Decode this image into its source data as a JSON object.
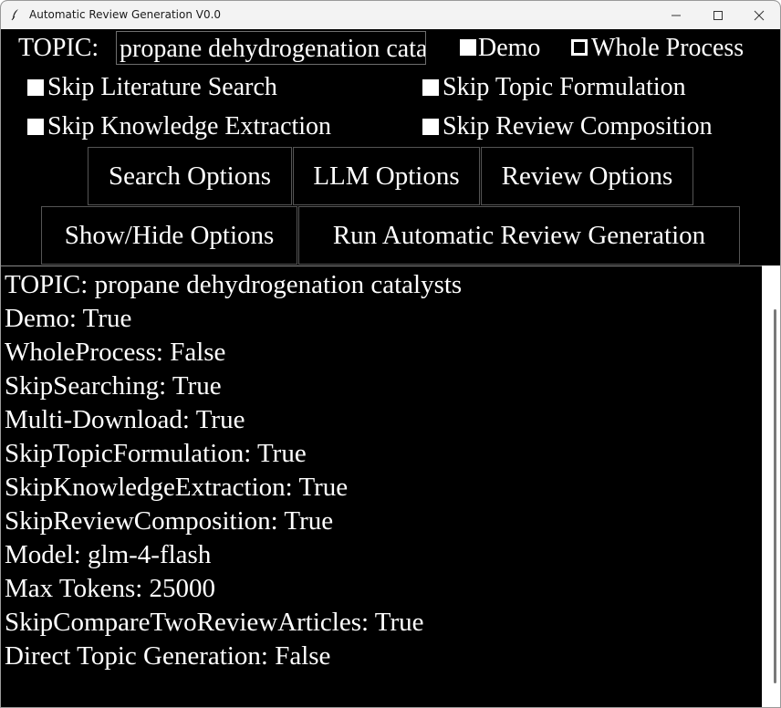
{
  "window": {
    "title": "Automatic Review Generation V0.0",
    "app_icon": "feather-icon"
  },
  "controls": {
    "topic_label": "TOPIC:",
    "topic_value": "propane dehydrogenation catalysts",
    "demo": {
      "label": "Demo",
      "checked": true
    },
    "whole_process": {
      "label": "Whole Process",
      "checked": false
    },
    "skip_literature_search": {
      "label": "Skip Literature Search",
      "checked": true
    },
    "skip_topic_formulation": {
      "label": "Skip Topic Formulation",
      "checked": true
    },
    "skip_knowledge_extraction": {
      "label": "Skip Knowledge Extraction",
      "checked": true
    },
    "skip_review_composition": {
      "label": "Skip Review Composition",
      "checked": true
    }
  },
  "buttons": {
    "search_options": "Search Options",
    "llm_options": "LLM Options",
    "review_options": "Review Options",
    "show_hide_options": "Show/Hide Options",
    "run": "Run Automatic Review Generation"
  },
  "output": {
    "lines": [
      "TOPIC: propane dehydrogenation catalysts",
      "Demo: True",
      "WholeProcess: False",
      "SkipSearching: True",
      "Multi-Download: True",
      "SkipTopicFormulation: True",
      "SkipKnowledgeExtraction: True",
      "SkipReviewComposition: True",
      "Model: glm-4-flash",
      "Max Tokens: 25000",
      "SkipCompareTwoReviewArticles: True",
      "Direct Topic Generation: False"
    ]
  }
}
